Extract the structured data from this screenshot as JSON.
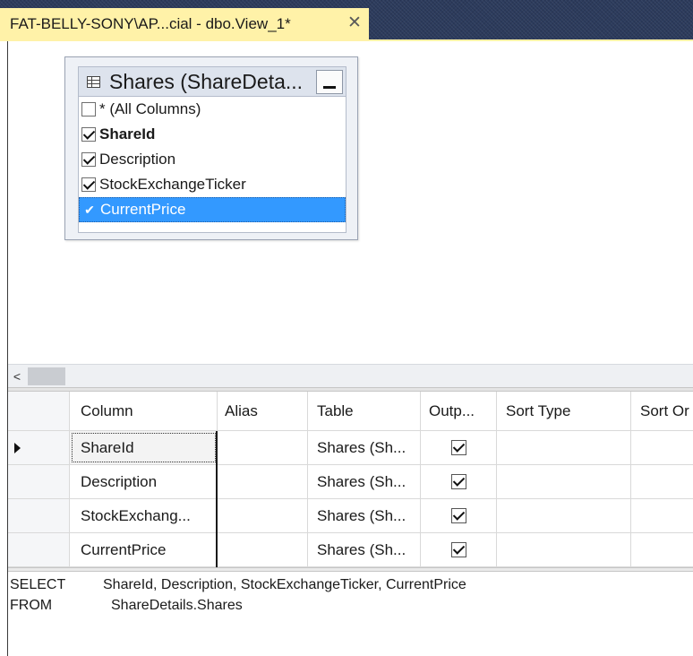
{
  "tab": {
    "title": "FAT-BELLY-SONY\\AP...cial - dbo.View_1*",
    "close_glyph": "✕"
  },
  "table_box": {
    "title": "Shares (ShareDeta...",
    "columns": [
      {
        "label": "* (All Columns)",
        "checked": false
      },
      {
        "label": "ShareId",
        "checked": true,
        "bold": true
      },
      {
        "label": "Description",
        "checked": true
      },
      {
        "label": "StockExchangeTicker",
        "checked": true
      },
      {
        "label": "CurrentPrice",
        "checked": true,
        "selected": true
      }
    ]
  },
  "scrollbar": {
    "left_glyph": "<"
  },
  "grid": {
    "headers": [
      "Column",
      "Alias",
      "Table",
      "Outp...",
      "Sort Type",
      "Sort Or"
    ],
    "rows": [
      {
        "column": "ShareId",
        "alias": "",
        "table": "Shares (Sh...",
        "output": true,
        "current": true
      },
      {
        "column": "Description",
        "alias": "",
        "table": "Shares (Sh...",
        "output": true
      },
      {
        "column": "StockExchang...",
        "alias": "",
        "table": "Shares (Sh...",
        "output": true
      },
      {
        "column": "CurrentPrice",
        "alias": "",
        "table": "Shares (Sh...",
        "output": true
      }
    ]
  },
  "sql": {
    "select_kw": "SELECT",
    "select_text": "ShareId, Description, StockExchangeTicker, CurrentPrice",
    "from_kw": "FROM",
    "from_text": "ShareDetails.Shares"
  },
  "colors": {
    "tab_bg": "#fff2a8",
    "header_bg": "#2c3b5c",
    "selection": "#3399ff"
  }
}
